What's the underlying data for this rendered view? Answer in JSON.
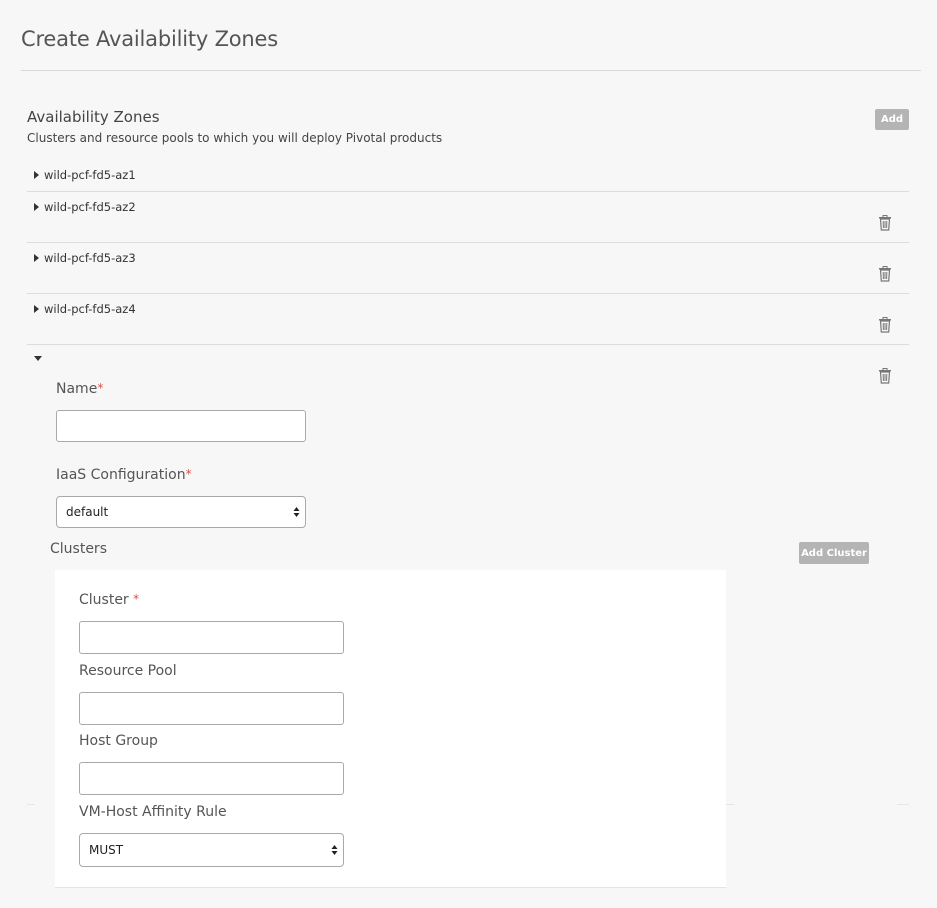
{
  "page": {
    "title": "Create Availability Zones"
  },
  "section": {
    "heading": "Availability Zones",
    "description": "Clusters and resource pools to which you will deploy Pivotal products",
    "add_label": "Add"
  },
  "zones": [
    {
      "name": "wild-pcf-fd5-az1",
      "expanded": false
    },
    {
      "name": "wild-pcf-fd5-az2",
      "expanded": false
    },
    {
      "name": "wild-pcf-fd5-az3",
      "expanded": false
    },
    {
      "name": "wild-pcf-fd5-az4",
      "expanded": false
    }
  ],
  "new_zone": {
    "name_label": "Name",
    "required_mark": "*",
    "name_value": "",
    "iaas_label": "IaaS Configuration",
    "iaas_selected": "default",
    "clusters_label": "Clusters",
    "add_cluster_label": "Add Cluster",
    "cluster": {
      "cluster_label": "Cluster",
      "cluster_value": "",
      "resource_pool_label": "Resource Pool",
      "resource_pool_value": "",
      "host_group_label": "Host Group",
      "host_group_value": "",
      "affinity_label": "VM-Host Affinity Rule",
      "affinity_selected": "MUST"
    }
  },
  "icons": {
    "expand": "caret-right-icon",
    "collapse": "caret-down-icon",
    "delete": "trash-icon",
    "select": "select-arrows-icon"
  },
  "colors": {
    "button_gray": "#b4b4b4",
    "required": "#d9534f",
    "background": "#f7f7f7"
  }
}
